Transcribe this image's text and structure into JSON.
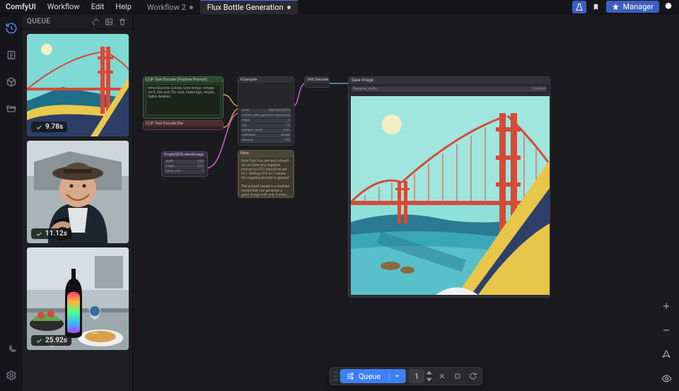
{
  "app": {
    "name": "ComfyUI"
  },
  "menu": {
    "workflow": "Workflow",
    "edit": "Edit",
    "help": "Help"
  },
  "tabs": [
    {
      "label": "Workflow 2",
      "active": false
    },
    {
      "label": "Flux Bottle Generation",
      "active": true
    }
  ],
  "topright": {
    "manager": "Manager"
  },
  "queue": {
    "title": "QUEUE",
    "items": [
      {
        "time": "9.78s"
      },
      {
        "time": "11.12s"
      },
      {
        "time": "25.92s"
      }
    ]
  },
  "nodes": {
    "clip_pos": {
      "title": "CLIP Text Encode (Positive Prompt)",
      "text": "retro-futuristic Golden Gate bridge, vintage sci-fi, 60s and 70s style, faded age, visuals, highly detailed"
    },
    "clip_neg": {
      "title": "CLIP Text Encode (Ne"
    },
    "empty_latent": {
      "title": "EmptySD3LatentImage",
      "rows": [
        {
          "k": "width",
          "v": "1024"
        },
        {
          "k": "height",
          "v": "1024"
        },
        {
          "k": "batch_size",
          "v": "1"
        }
      ]
    },
    "ksampler": {
      "title": "KSampler",
      "rows": [
        {
          "k": "seed",
          "v": "483139545574"
        },
        {
          "k": "control_after_generate",
          "v": "randomize"
        },
        {
          "k": "steps",
          "v": "4"
        },
        {
          "k": "cfg",
          "v": "1.0"
        },
        {
          "k": "sampler_name",
          "v": "euler"
        },
        {
          "k": "scheduler",
          "v": "simple"
        },
        {
          "k": "denoise",
          "v": "1.00"
        }
      ]
    },
    "vae": {
      "title": "VAE Decode"
    },
    "save": {
      "title": "Save Image",
      "filename_label": "filename_prefix",
      "filename_value": "ComfyUI"
    },
    "note": {
      "title": "Note",
      "text": "Note that Flux dev and schnell do not have any negative prompt so CFG should be set to 1. Setting CFG to 1 means the negative prompt is ignored.\n\nThe schnell model is a distilled model that can generate a good image with only 4 steps."
    }
  },
  "bottom": {
    "queue_label": "Queue",
    "count": "1"
  }
}
